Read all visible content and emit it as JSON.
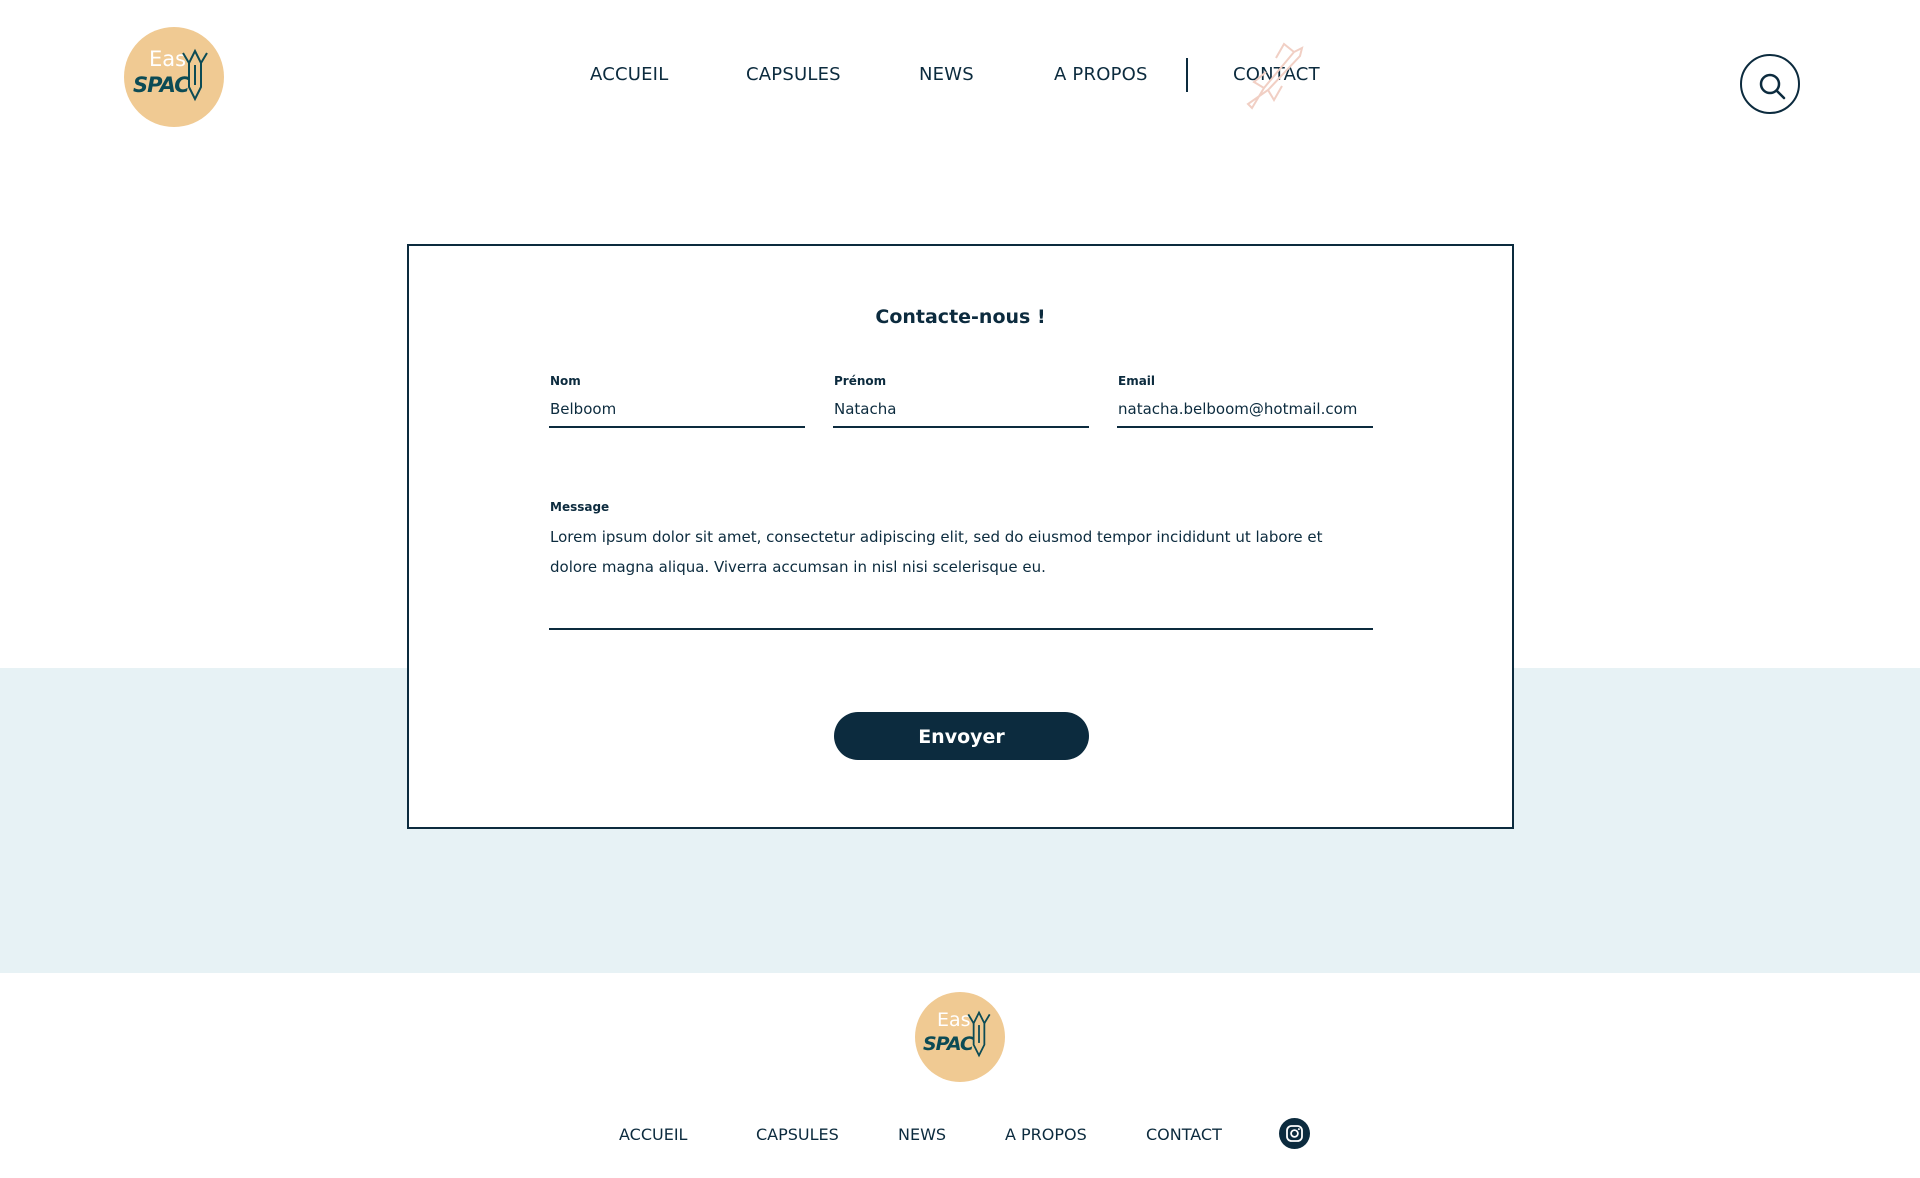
{
  "brand": {
    "logo_top": "Eas",
    "logo_bottom": "SPAC",
    "colors": {
      "logo_bg": "#f0ca93",
      "primary": "#0c2b3e",
      "band": "#e7f2f5",
      "logo_accent": "#0c4b55"
    }
  },
  "header": {
    "nav": [
      {
        "label": "ACCUEIL"
      },
      {
        "label": "CAPSULES"
      },
      {
        "label": "NEWS"
      },
      {
        "label": "A PROPOS"
      },
      {
        "label": "CONTACT"
      }
    ],
    "search_icon": "search-icon"
  },
  "form": {
    "title": "Contacte-nous !",
    "fields": {
      "nom": {
        "label": "Nom",
        "value": "Belboom"
      },
      "prenom": {
        "label": "Prénom",
        "value": "Natacha"
      },
      "email": {
        "label": "Email",
        "value": "natacha.belboom@hotmail.com"
      },
      "message": {
        "label": "Message",
        "value": "Lorem ipsum dolor sit amet, consectetur adipiscing elit, sed do eiusmod tempor incididunt ut labore et dolore magna aliqua. Viverra accumsan in nisl nisi scelerisque eu."
      }
    },
    "submit_label": "Envoyer"
  },
  "footer": {
    "nav": [
      {
        "label": "ACCUEIL"
      },
      {
        "label": "CAPSULES"
      },
      {
        "label": "NEWS"
      },
      {
        "label": "A PROPOS"
      },
      {
        "label": "CONTACT"
      }
    ],
    "social_icon": "instagram-icon"
  }
}
